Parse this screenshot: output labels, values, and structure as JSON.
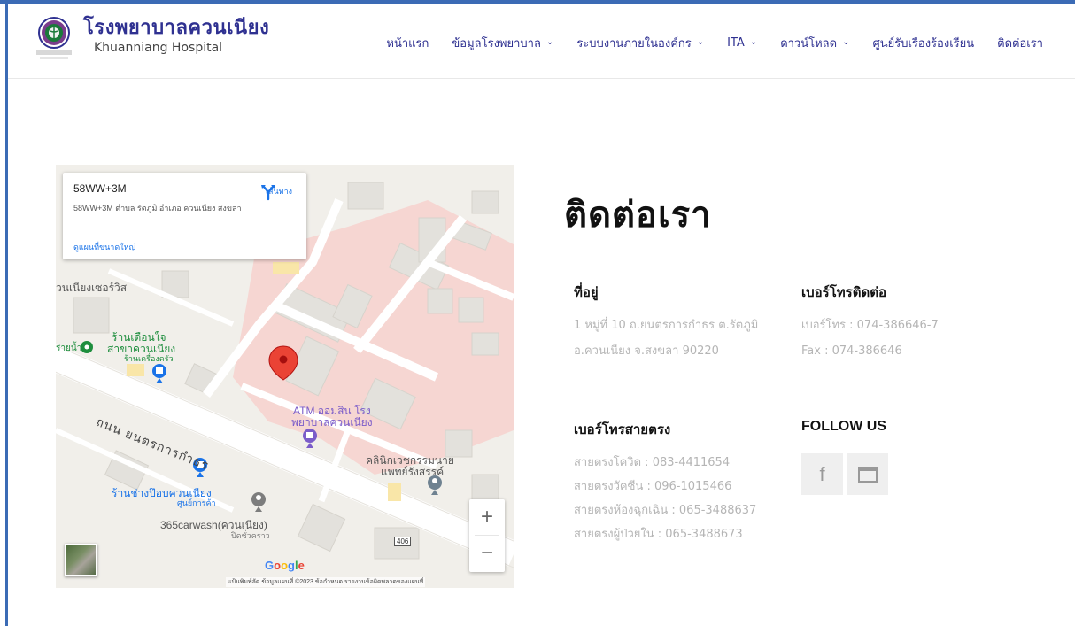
{
  "header": {
    "brand_th": "โรงพยาบาลควนเนียง",
    "brand_en": "Khuanniang Hospital",
    "nav": [
      {
        "label": "หน้าแรก",
        "dropdown": false
      },
      {
        "label": "ข้อมูลโรงพยาบาล",
        "dropdown": true
      },
      {
        "label": "ระบบงานภายในองค์กร",
        "dropdown": true
      },
      {
        "label": "ITA",
        "dropdown": true
      },
      {
        "label": "ดาวน์โหลด",
        "dropdown": true
      },
      {
        "label": "ศูนย์รับเรื่องร้องเรียน",
        "dropdown": false
      },
      {
        "label": "ติดต่อเรา",
        "dropdown": false
      }
    ],
    "chevron": "⌄"
  },
  "map": {
    "card": {
      "title": "58WW+3M",
      "address": "58WW+3M ตำบล รัตภูมิ อำเภอ ควนเนียง สงขลา",
      "directions": "เส้นทาง",
      "larger_map": "ดูแผนที่ขนาดใหญ่"
    },
    "labels": {
      "area": "วนเนียงเซอร์วิส",
      "shop1_a": "ร้านเดือนใจ",
      "shop1_b": "สาขาควนเนียง",
      "shop1_c": "ร้านเครื่องครัว",
      "water": "ร่ายน้ำ",
      "road": "ถนน ยนตรการกำธร",
      "atm_a": "ATM ออมสิน โรง",
      "atm_b": "พยาบาลควนเนียง",
      "clinic_a": "คลินิกเวชกรรมนาย",
      "clinic_b": "แพทย์รังสรรค์",
      "shop2_a": "ร้านช่างป๊อบควนเนียง",
      "shop2_b": "ศูนย์การค้า",
      "carwash_a": "365carwash(ควนเนียง)",
      "carwash_b": "ปิดชั่วคราว",
      "route": "406"
    },
    "zoom_in": "+",
    "zoom_out": "−",
    "google": "Google",
    "footer": "แป้นพิมพ์ลัด   ข้อมูลแผนที่ ©2023   ข้อกำหนด   รายงานข้อผิดพลาดของแผนที่"
  },
  "contact": {
    "title": "ติดต่อเรา",
    "address": {
      "heading": "ที่อยู่",
      "lines": [
        "1 หมู่ที่ 10 ถ.ยนตรการกำธร ต.รัตภูมิ",
        "อ.ควนเนียง จ.สงขลา 90220"
      ]
    },
    "phone": {
      "heading": "เบอร์โทรติดต่อ",
      "lines": [
        "เบอร์โทร : 074-386646-7",
        "Fax : 074-386646"
      ]
    },
    "direct": {
      "heading": "เบอร์โทรสายตรง",
      "lines": [
        "สายตรงโควิด : 083-4411654",
        "สายตรงวัคซีน : 096-1015466",
        "สายตรงห้องฉุกเฉิน : 065-3488637",
        "สายตรงผู้ป่วยใน : 065-3488673"
      ]
    },
    "follow": {
      "heading": "FOLLOW US",
      "facebook_glyph": "f"
    }
  },
  "colors": {
    "brand": "#2f3191",
    "frame": "#3b6bb5",
    "muted_text": "#b5b5b5",
    "hospital_area": "#f6d2cf",
    "pin": "#ea4335"
  }
}
